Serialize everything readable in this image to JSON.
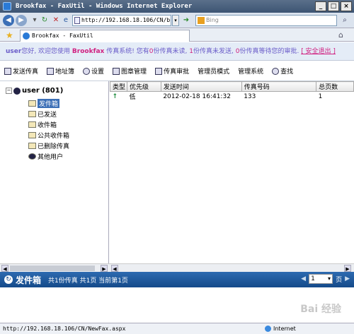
{
  "window": {
    "title": "Brookfax - FaxUtil - Windows Internet Explorer",
    "btn_min": "_",
    "btn_max": "□",
    "btn_close": "×"
  },
  "browser": {
    "url": "http://192.168.18.106/CN/b",
    "search_placeholder": "Bing",
    "tab_title": "Brookfax - FaxUtil"
  },
  "welcome": {
    "user": "user",
    "greeting": "您好, 欢迎您使用",
    "brand": "Brookfax",
    "part1": "传真系统! 您有",
    "n_unread": "0",
    "part2": "份传真未读,",
    "n_unsent": "1",
    "part3": "份传真未发送,",
    "n_pending": "0",
    "part4": "份传真等待您的审批.",
    "logout": "[ 安全退出 ]"
  },
  "toolbar": {
    "items": [
      "发送传真",
      "地址簿",
      "设置",
      "图章管理",
      "传真审批",
      "管理员模式",
      "管理系统",
      "查找"
    ]
  },
  "tree": {
    "root": "user (801)",
    "items": [
      "发件箱",
      "已发送",
      "收件箱",
      "公共收件箱",
      "已删除传真",
      "其他用户"
    ]
  },
  "grid": {
    "headers": [
      "类型",
      "优先级",
      "发送时间",
      "传真号码",
      "总页数"
    ],
    "rows": [
      {
        "type_icon": "↑",
        "priority": "低",
        "time": "2012-02-18 16:41:32",
        "number": "133",
        "pages": "1"
      }
    ]
  },
  "statusbar": {
    "title": "发件箱",
    "info": "共1份传真  共1页  当前第1页",
    "page_value": "1",
    "page_suffix": "页"
  },
  "ie_status": {
    "url": "http://192.168.18.106/CN/NewFax.aspx",
    "zone": "Internet"
  },
  "watermark": "Bai 经验"
}
